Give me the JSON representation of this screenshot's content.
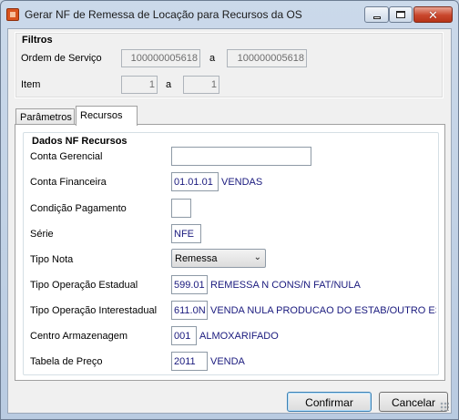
{
  "window": {
    "title": "Gerar NF de Remessa de Locação para Recursos da OS"
  },
  "filtros": {
    "heading": "Filtros",
    "ordem_label": "Ordem de Serviço",
    "ordem_from": "100000005618",
    "ordem_sep": "a",
    "ordem_to": "100000005618",
    "item_label": "Item",
    "item_from": "1",
    "item_sep": "a",
    "item_to": "1"
  },
  "tabs": [
    {
      "label": "Parâmetros",
      "active": false
    },
    {
      "label": "Recursos",
      "active": true
    }
  ],
  "recursos": {
    "heading": "Dados NF Recursos",
    "conta_gerencial": {
      "label": "Conta Gerencial",
      "value": ""
    },
    "conta_financeira": {
      "label": "Conta Financeira",
      "value": "01.01.01",
      "desc": "VENDAS"
    },
    "condicao_pagamento": {
      "label": "Condição Pagamento",
      "value": ""
    },
    "serie": {
      "label": "Série",
      "value": "NFE"
    },
    "tipo_nota": {
      "label": "Tipo Nota",
      "selected": "Remessa"
    },
    "tipo_op_estadual": {
      "label": "Tipo Operação Estadual",
      "value": "599.01",
      "desc": "REMESSA N CONS/N FAT/NULA"
    },
    "tipo_op_interestadual": {
      "label": "Tipo Operação Interestadual",
      "value": "611.0N",
      "desc": "VENDA NULA PRODUCAO DO ESTAB/OUTRO ESTADO"
    },
    "centro_armazenagem": {
      "label": "Centro Armazenagem",
      "value": "001",
      "desc": "ALMOXARIFADO"
    },
    "tabela_preco": {
      "label": "Tabela de Preço",
      "value": "2011",
      "desc": "VENDA"
    }
  },
  "buttons": {
    "confirm": "Confirmar",
    "cancel": "Cancelar"
  },
  "colors": {
    "value_text": "#1a1a7e",
    "title_bar": "#cbd9ea",
    "close_button": "#c9462c"
  }
}
